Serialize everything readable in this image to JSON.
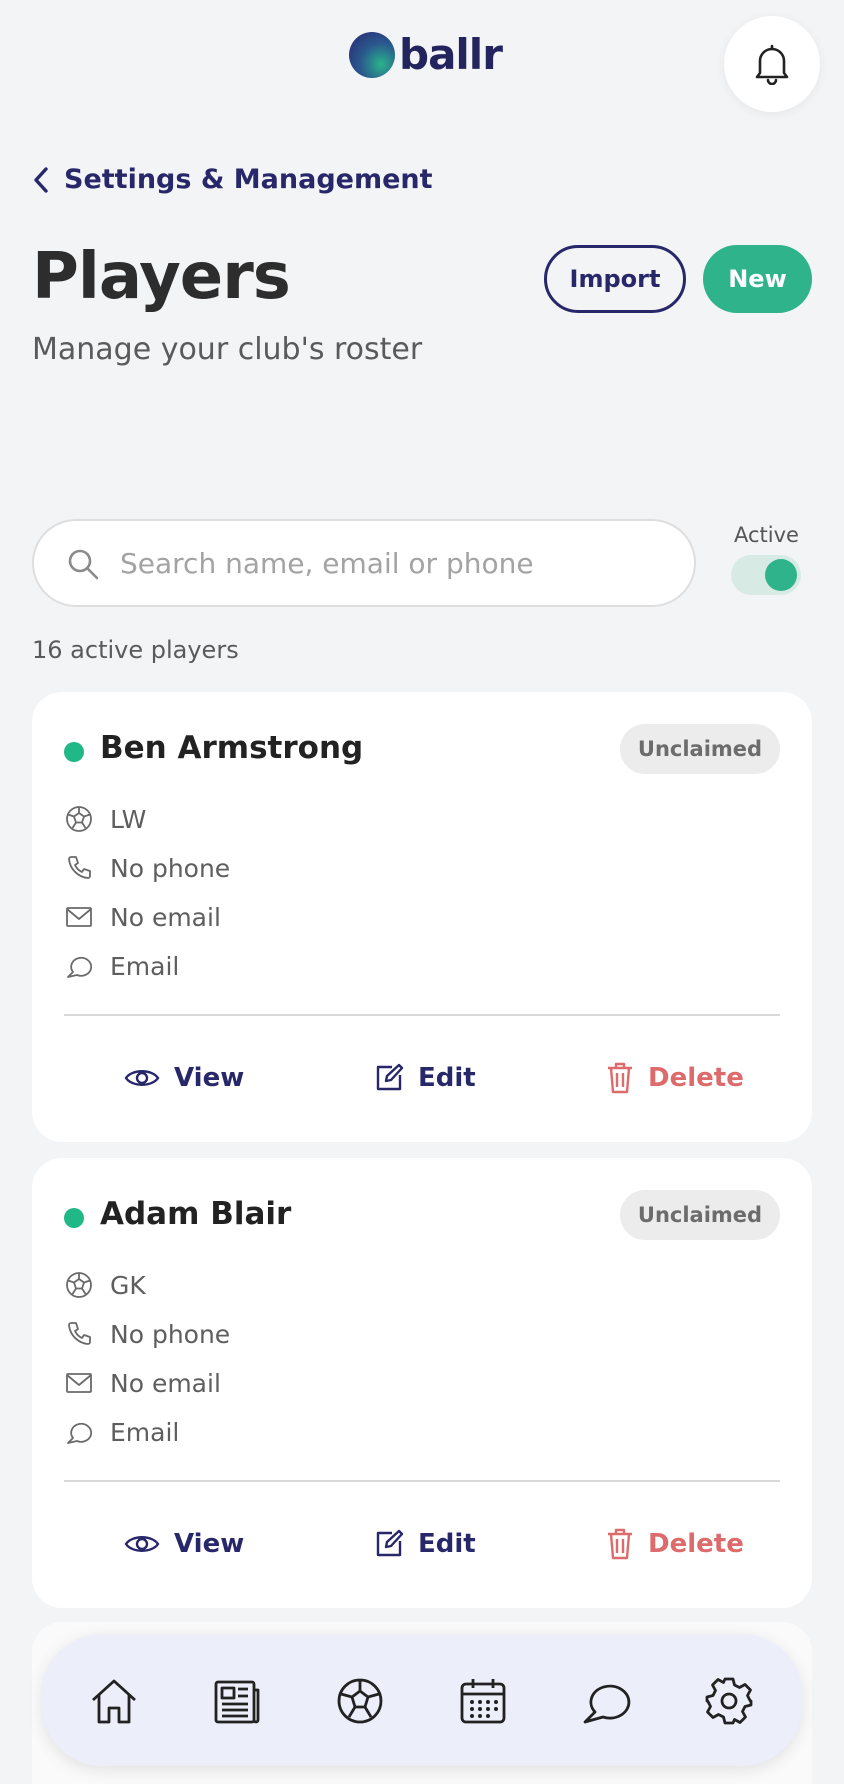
{
  "brand": {
    "name": "ballr"
  },
  "header": {
    "back_label": "Settings & Management",
    "title": "Players",
    "subtitle": "Manage your club's roster",
    "import_label": "Import",
    "new_label": "New"
  },
  "search": {
    "placeholder": "Search name, email or phone",
    "value": ""
  },
  "filter": {
    "active_label": "Active",
    "active_on": true
  },
  "roster": {
    "count_text": "16 active players"
  },
  "players": [
    {
      "name": "Ben Armstrong",
      "status": "Unclaimed",
      "position": "LW",
      "phone": "No phone",
      "email": "No email",
      "contact_pref": "Email"
    },
    {
      "name": "Adam Blair",
      "status": "Unclaimed",
      "position": "GK",
      "phone": "No phone",
      "email": "No email",
      "contact_pref": "Email"
    }
  ],
  "actions": {
    "view": "View",
    "edit": "Edit",
    "delete": "Delete"
  },
  "nav": {
    "items": [
      {
        "icon": "home-icon"
      },
      {
        "icon": "news-icon"
      },
      {
        "icon": "football-icon"
      },
      {
        "icon": "calendar-icon"
      },
      {
        "icon": "chat-icon"
      },
      {
        "icon": "gear-icon"
      }
    ]
  },
  "colors": {
    "brand_navy": "#27276a",
    "accent_green": "#2fb38b",
    "delete_red": "#dd6b6b",
    "background": "#f3f4f6"
  }
}
